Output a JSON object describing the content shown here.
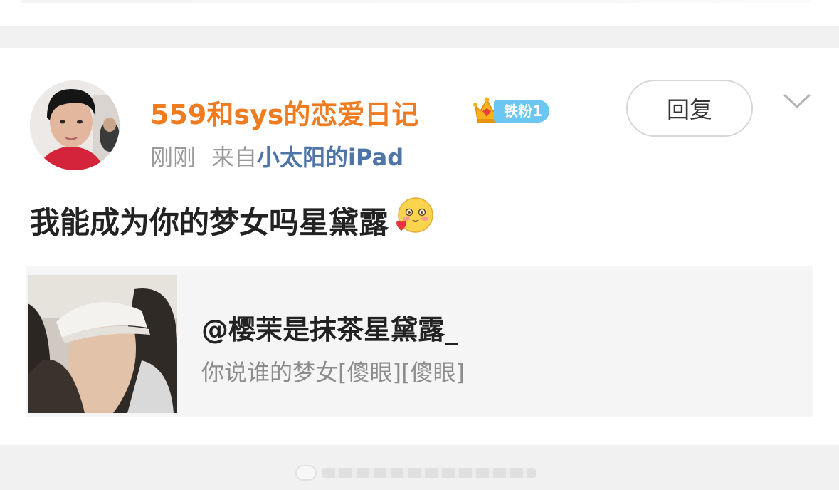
{
  "comment": {
    "username": "559和sys的恋爱日记",
    "fan_badge": {
      "icon": "crown-icon",
      "label": "铁粉1",
      "color": "#6cc6f2"
    },
    "time": "刚刚",
    "source_prefix": "来自",
    "source_device": "小太阳的iPad",
    "reply_label": "回复",
    "more_icon": "chevron-down-icon",
    "text": "我能成为你的梦女吗星黛露",
    "emoji": "blush-heart-emoji",
    "username_color": "#f07c22",
    "device_color": "#4f74a8"
  },
  "quoted": {
    "user": "@樱茉是抹茶星黛露_",
    "text": "你说谁的梦女[傻眼][傻眼]"
  }
}
